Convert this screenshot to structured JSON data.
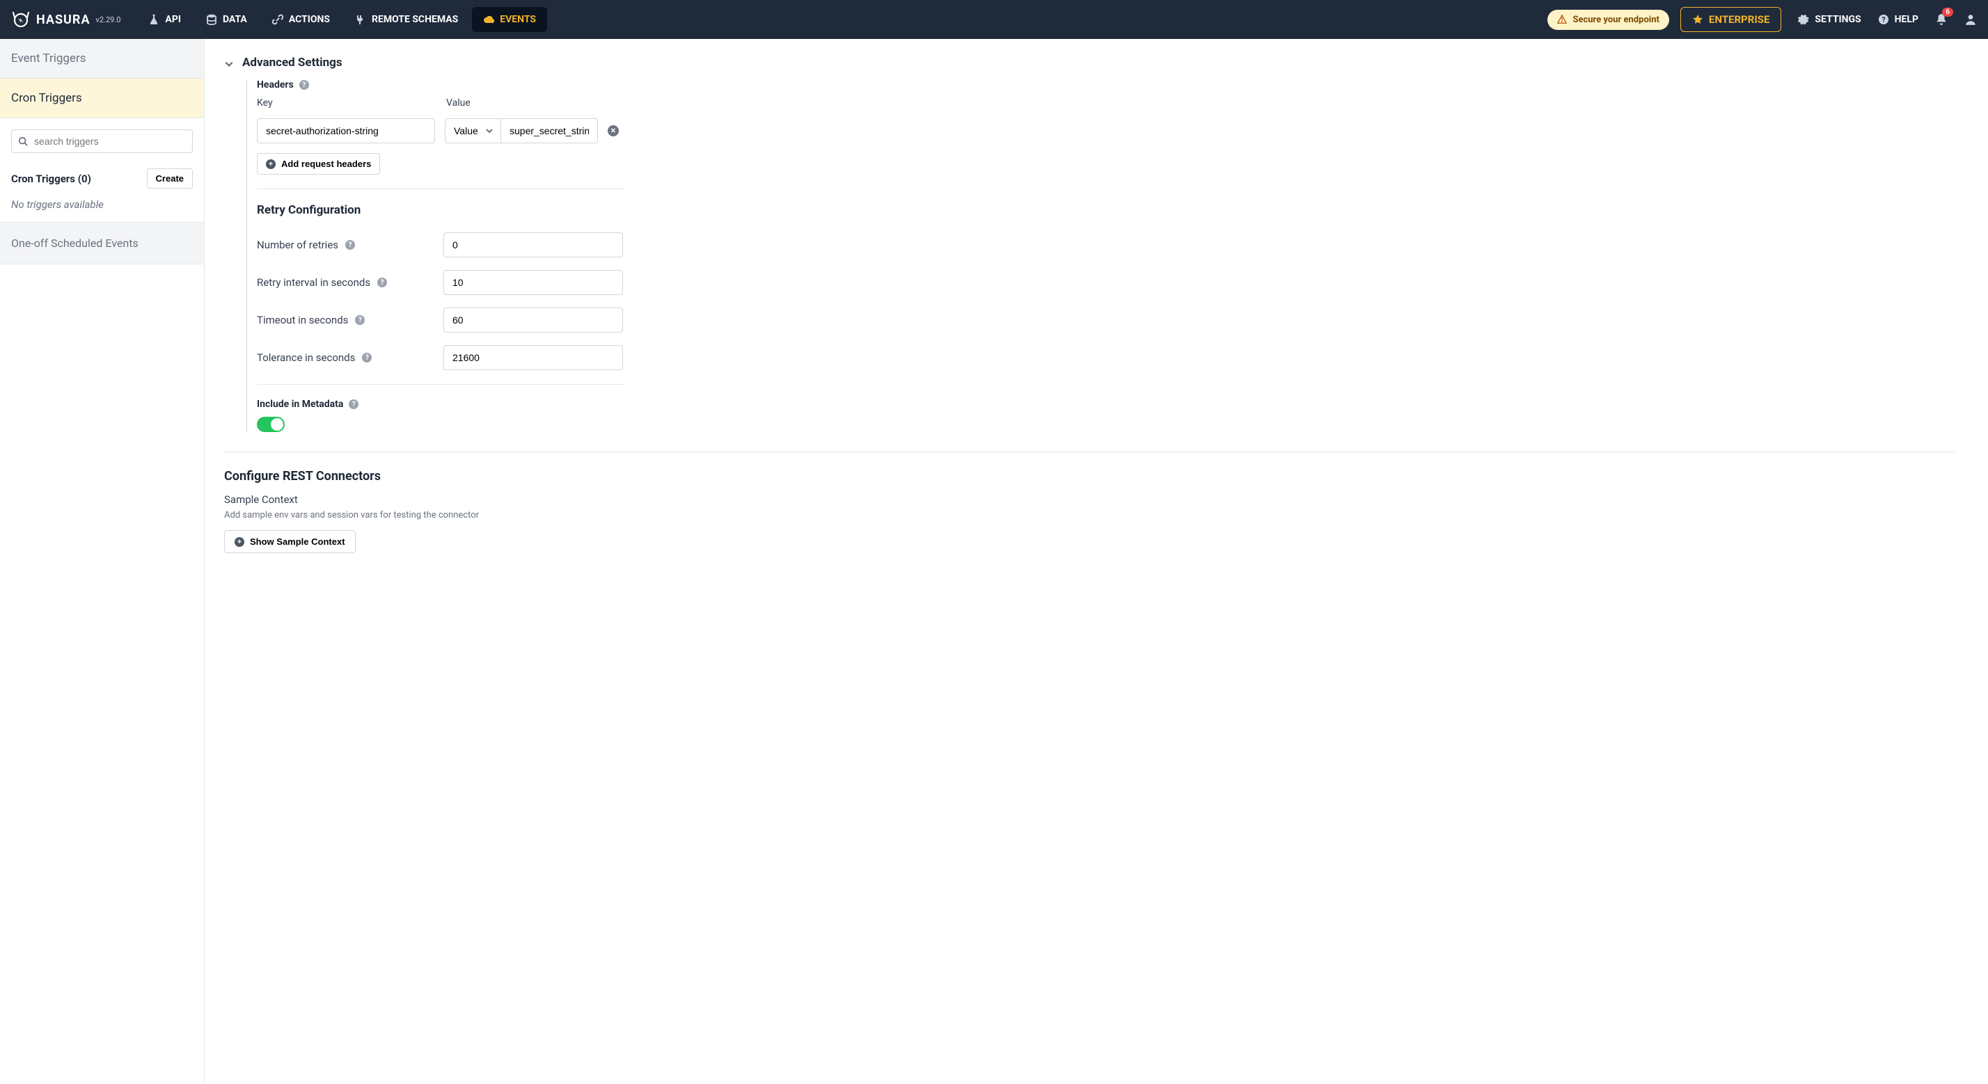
{
  "app": {
    "name": "HASURA",
    "version": "v2.29.0"
  },
  "nav": {
    "items": [
      {
        "label": "API"
      },
      {
        "label": "DATA"
      },
      {
        "label": "ACTIONS"
      },
      {
        "label": "REMOTE SCHEMAS"
      },
      {
        "label": "EVENTS"
      }
    ],
    "active_index": 4,
    "secure_label": "Secure your endpoint",
    "enterprise_label": "ENTERPRISE",
    "settings_label": "SETTINGS",
    "help_label": "HELP",
    "notification_count": "6"
  },
  "sidebar": {
    "tabs": {
      "event_triggers": "Event Triggers",
      "cron_triggers": "Cron Triggers",
      "one_off": "One-off Scheduled Events"
    },
    "search_placeholder": "search triggers",
    "cron_header": "Cron Triggers (0)",
    "create_label": "Create",
    "empty_text": "No triggers available"
  },
  "advanced": {
    "title": "Advanced Settings",
    "headers_label": "Headers",
    "key_col": "Key",
    "value_col": "Value",
    "header_row": {
      "key": "secret-authorization-string",
      "type": "Value",
      "value": "super_secret_string"
    },
    "add_headers_label": "Add request headers",
    "retry": {
      "title": "Retry Configuration",
      "rows": [
        {
          "label": "Number of retries",
          "value": "0"
        },
        {
          "label": "Retry interval in seconds",
          "value": "10"
        },
        {
          "label": "Timeout in seconds",
          "value": "60"
        },
        {
          "label": "Tolerance in seconds",
          "value": "21600"
        }
      ]
    },
    "include_metadata_label": "Include in Metadata",
    "include_metadata_on": true
  },
  "rest": {
    "title": "Configure REST Connectors",
    "sample_context": "Sample Context",
    "sample_desc": "Add sample env vars and session vars for testing the connector",
    "show_btn": "Show Sample Context"
  }
}
